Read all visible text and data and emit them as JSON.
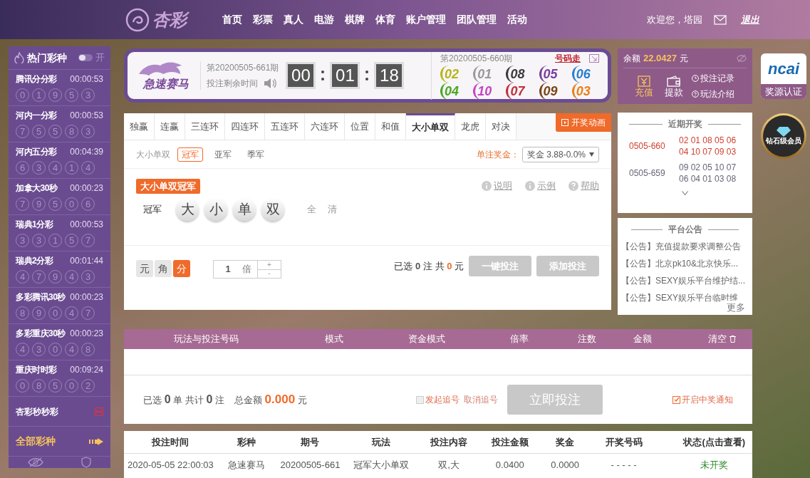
{
  "header": {
    "logo_text": "杏彩",
    "nav": [
      "首页",
      "彩票",
      "真人",
      "电游",
      "棋牌",
      "体育",
      "账户管理",
      "团队管理",
      "活动"
    ],
    "welcome": "欢迎您，塔园",
    "logout": "退出"
  },
  "hot": {
    "title": "热门彩种",
    "toggle": {
      "label": "开",
      "on": false
    },
    "items": [
      {
        "name": "腾讯分分彩",
        "time": "00:00:53",
        "balls": [
          "0",
          "1",
          "9",
          "5",
          "3"
        ]
      },
      {
        "name": "河内一分彩",
        "time": "00:00:53",
        "balls": [
          "7",
          "5",
          "5",
          "8",
          "3"
        ]
      },
      {
        "name": "河内五分彩",
        "time": "00:04:39",
        "balls": [
          "6",
          "3",
          "4",
          "1",
          "4"
        ]
      },
      {
        "name": "加拿大30秒",
        "time": "00:00:23",
        "balls": [
          "7",
          "9",
          "5",
          "0",
          "6"
        ]
      },
      {
        "name": "瑞典1分彩",
        "time": "00:00:53",
        "balls": [
          "3",
          "3",
          "1",
          "5",
          "7"
        ]
      },
      {
        "name": "瑞典2分彩",
        "time": "00:01:44",
        "balls": [
          "4",
          "7",
          "9",
          "4",
          "3"
        ]
      },
      {
        "name": "多彩腾讯30秒",
        "time": "00:00:23",
        "balls": [
          "8",
          "9",
          "0",
          "4",
          "7"
        ]
      },
      {
        "name": "多彩重庆30秒",
        "time": "00:00:23",
        "balls": [
          "4",
          "3",
          "0",
          "4",
          "8"
        ]
      },
      {
        "name": "重庆时时彩",
        "time": "00:09:24",
        "balls": [
          "0",
          "8",
          "5",
          "0",
          "2"
        ]
      }
    ],
    "extra": "杏彩秒秒彩",
    "all": "全部彩种"
  },
  "game": {
    "name": "急速赛马",
    "period": "第20200505-661期",
    "remaining_label": "投注剩余时间",
    "countdown": [
      "00",
      "01",
      "18"
    ],
    "last_period": "第20200505-660期",
    "trend_link": "号码走",
    "last_numbers": [
      {
        "value": "02",
        "color": "#b8b41c"
      },
      {
        "value": "01",
        "color": "#9a9a9a"
      },
      {
        "value": "08",
        "color": "#3a3a3a"
      },
      {
        "value": "05",
        "color": "#7a3c9e"
      },
      {
        "value": "06",
        "color": "#2a7fd0"
      },
      {
        "value": "04",
        "color": "#4aa824"
      },
      {
        "value": "10",
        "color": "#c444c4"
      },
      {
        "value": "07",
        "color": "#c0303c"
      },
      {
        "value": "09",
        "color": "#7a4418"
      },
      {
        "value": "03",
        "color": "#e8801a"
      }
    ]
  },
  "tabs": [
    {
      "label": "独赢",
      "selected": false
    },
    {
      "label": "连赢",
      "selected": false
    },
    {
      "label": "三连环",
      "selected": false
    },
    {
      "label": "四连环",
      "selected": false
    },
    {
      "label": "五连环",
      "selected": false
    },
    {
      "label": "六连环",
      "selected": false
    },
    {
      "label": "位置",
      "selected": false
    },
    {
      "label": "和值",
      "selected": false
    },
    {
      "label": "大小单双",
      "selected": true
    },
    {
      "label": "龙虎",
      "selected": false
    },
    {
      "label": "对决",
      "selected": false
    }
  ],
  "animation_button": "开奖动画",
  "subtabs": {
    "group": "大小单双",
    "options": [
      {
        "label": "冠军",
        "selected": true
      },
      {
        "label": "亚军",
        "selected": false
      },
      {
        "label": "季军",
        "selected": false
      }
    ]
  },
  "prize": {
    "label": "单注奖金：",
    "value": "奖金 3.88-0.0%"
  },
  "bet": {
    "tag": "大小单双冠军",
    "help_links": [
      "说明",
      "示例",
      "帮助"
    ],
    "row_label": "冠军",
    "balls": [
      {
        "label": "大",
        "selected": false
      },
      {
        "label": "小",
        "selected": false
      },
      {
        "label": "单",
        "selected": false
      },
      {
        "label": "双",
        "selected": false
      }
    ],
    "actions": [
      "全",
      "清"
    ]
  },
  "order": {
    "units": [
      {
        "label": "元",
        "selected": false
      },
      {
        "label": "角",
        "selected": false
      },
      {
        "label": "分",
        "selected": true
      }
    ],
    "multiplier": "1",
    "multiplier_unit": "倍",
    "plus": "+",
    "minus": "-",
    "summary": {
      "selected_label": "已选",
      "selected_count": "0",
      "bets_unit": "注",
      "total_label": "共",
      "total": "0",
      "currency": "元"
    },
    "buttons": [
      {
        "label": "一键投注",
        "disabled": true
      },
      {
        "label": "添加投注",
        "disabled": true
      }
    ]
  },
  "cart": {
    "columns": [
      "玩法与投注号码",
      "模式",
      "资金模式",
      "倍率",
      "注数",
      "金额"
    ],
    "clear": "清空"
  },
  "footer": {
    "selected_label": "已选",
    "orders": "0",
    "orders_unit": "单 共计",
    "bets": "0",
    "bets_unit": "注",
    "total_label": "总金额",
    "total": "0.000",
    "currency": "元",
    "chase": {
      "label": "发起追号",
      "checked": false
    },
    "cancel_chase": "取消追号",
    "submit": {
      "label": "立即投注",
      "disabled": true
    },
    "notify": {
      "label": "开启中奖通知",
      "checked": true
    }
  },
  "records": {
    "columns": [
      "投注时间",
      "彩种",
      "期号",
      "玩法",
      "投注内容",
      "投注金额",
      "奖金",
      "开奖号码",
      "状态(点击查看)"
    ],
    "rows": [
      [
        "2020-05-05 22:00:03",
        "急速赛马",
        "20200505-661",
        "冠军大小单双",
        "双,大",
        "0.0400",
        "0.0000",
        "- - - - -",
        "未开奖"
      ]
    ]
  },
  "account": {
    "balance_label": "余额",
    "balance": "22.0427",
    "currency": "元",
    "actions": [
      {
        "label": "充值",
        "kind": "deposit",
        "selected": true
      },
      {
        "label": "提款",
        "kind": "withdraw",
        "selected": false
      }
    ],
    "links": [
      {
        "label": "投注记录",
        "kind": "record"
      },
      {
        "label": "玩法介绍",
        "kind": "help"
      }
    ]
  },
  "recent": {
    "title": "近期开奖",
    "rows": [
      {
        "period": "0505-660",
        "numbers": [
          "02 01 08 05 06",
          "04 10 07 09 03"
        ],
        "latest": true
      },
      {
        "period": "0505-659",
        "numbers": [
          "09 02 05 10 07",
          "06 04 01 03 08"
        ],
        "latest": false
      }
    ]
  },
  "notices": {
    "title": "平台公告",
    "items": [
      "【公告】充值提款要求调整公告",
      "【公告】北京pk10&北京快乐...",
      "【公告】SEXY娱乐平台维护结...",
      "【公告】SEXY娱乐平台临时维"
    ],
    "more": "更多"
  },
  "badges": {
    "logo": "ncai",
    "cert": "奖源认证",
    "member": "钻石级会员"
  }
}
